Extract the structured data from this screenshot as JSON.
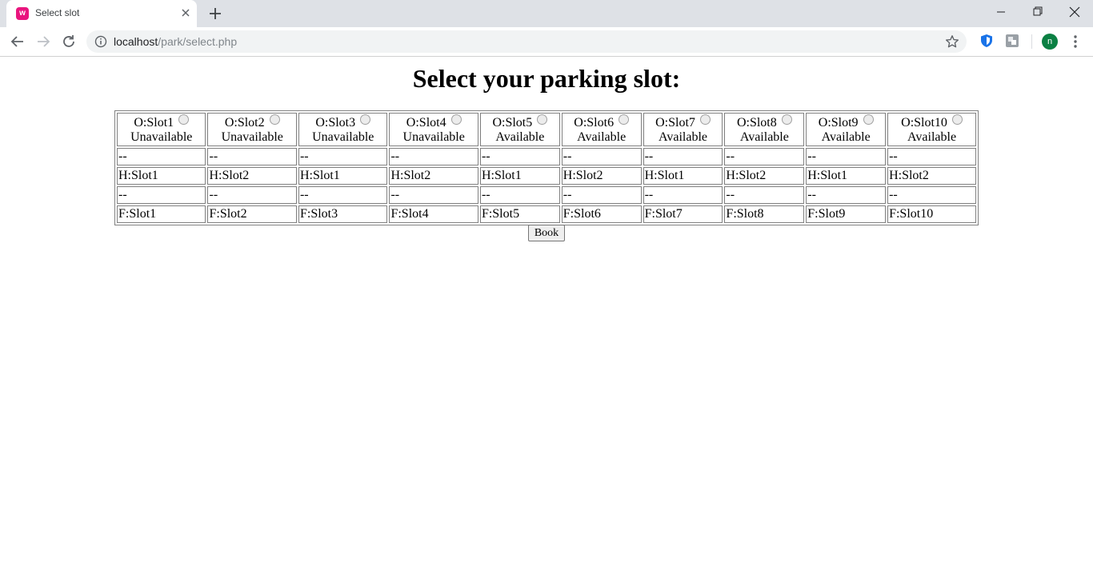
{
  "browser": {
    "tab_title": "Select slot",
    "favicon_letter": "w",
    "url_host": "localhost",
    "url_path": "/park/select.php",
    "profile_initial": "n"
  },
  "page": {
    "title": "Select your parking slot:",
    "book_label": "Book"
  },
  "slots": {
    "o_row": [
      {
        "label": "O:Slot1",
        "status": "Unavailable"
      },
      {
        "label": "O:Slot2",
        "status": "Unavailable"
      },
      {
        "label": "O:Slot3",
        "status": "Unavailable"
      },
      {
        "label": "O:Slot4",
        "status": "Unavailable"
      },
      {
        "label": "O:Slot5",
        "status": "Available"
      },
      {
        "label": "O:Slot6",
        "status": "Available"
      },
      {
        "label": "O:Slot7",
        "status": "Available"
      },
      {
        "label": "O:Slot8",
        "status": "Available"
      },
      {
        "label": "O:Slot9",
        "status": "Available"
      },
      {
        "label": "O:Slot10",
        "status": "Available"
      }
    ],
    "separator": "--",
    "h_row": [
      "H:Slot1",
      "H:Slot2",
      "H:Slot1",
      "H:Slot2",
      "H:Slot1",
      "H:Slot2",
      "H:Slot1",
      "H:Slot2",
      "H:Slot1",
      "H:Slot2"
    ],
    "f_row": [
      "F:Slot1",
      "F:Slot2",
      "F:Slot3",
      "F:Slot4",
      "F:Slot5",
      "F:Slot6",
      "F:Slot7",
      "F:Slot8",
      "F:Slot9",
      "F:Slot10"
    ]
  }
}
